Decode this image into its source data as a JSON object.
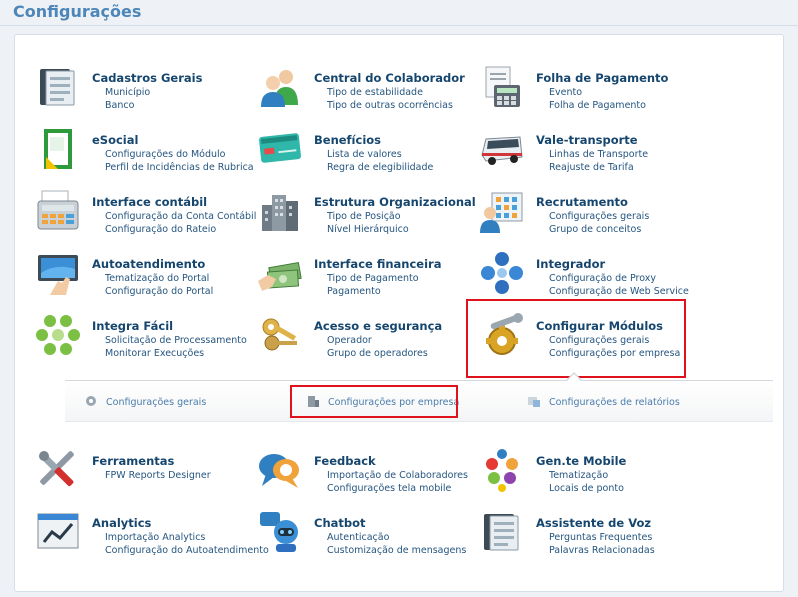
{
  "page": {
    "title": "Configurações"
  },
  "modules": {
    "cadastros": {
      "title": "Cadastros Gerais",
      "links": [
        "Município",
        "Banco"
      ]
    },
    "colaborador": {
      "title": "Central do Colaborador",
      "links": [
        "Tipo de estabilidade",
        "Tipo de outras ocorrências"
      ]
    },
    "folha": {
      "title": "Folha de Pagamento",
      "links": [
        "Evento",
        "Folha de Pagamento"
      ]
    },
    "esocial": {
      "title": "eSocial",
      "links": [
        "Configurações do Módulo",
        "Perfil de Incidências de Rubrica"
      ]
    },
    "beneficios": {
      "title": "Benefícios",
      "links": [
        "Lista de valores",
        "Regra de elegibilidade"
      ]
    },
    "vale": {
      "title": "Vale-transporte",
      "links": [
        "Linhas de Transporte",
        "Reajuste de Tarifa"
      ]
    },
    "contabil": {
      "title": "Interface contábil",
      "links": [
        "Configuração da Conta Contábil",
        "Configuração do Rateio"
      ]
    },
    "estrutura": {
      "title": "Estrutura Organizacional",
      "links": [
        "Tipo de Posição",
        "Nível Hierárquico"
      ]
    },
    "recrutamento": {
      "title": "Recrutamento",
      "links": [
        "Configurações gerais",
        "Grupo de conceitos"
      ]
    },
    "autoatendimento": {
      "title": "Autoatendimento",
      "links": [
        "Tematização do Portal",
        "Configuração do Portal"
      ]
    },
    "financeira": {
      "title": "Interface financeira",
      "links": [
        "Tipo de Pagamento",
        "Pagamento"
      ]
    },
    "integrador": {
      "title": "Integrador",
      "links": [
        "Configuração de Proxy",
        "Configuração de Web Service"
      ]
    },
    "integra": {
      "title": "Integra Fácil",
      "links": [
        "Solicitação de Processamento",
        "Monitorar Execuções"
      ]
    },
    "acesso": {
      "title": "Acesso e segurança",
      "links": [
        "Operador",
        "Grupo de operadores"
      ]
    },
    "modulos": {
      "title": "Configurar Módulos",
      "links": [
        "Configurações gerais",
        "Configurações por empresa"
      ]
    },
    "ferramentas": {
      "title": "Ferramentas",
      "links": [
        "FPW Reports Designer"
      ]
    },
    "feedback": {
      "title": "Feedback",
      "links": [
        "Importação de Colaboradores",
        "Configurações tela mobile"
      ]
    },
    "mobile": {
      "title": "Gen.te Mobile",
      "links": [
        "Tematização",
        "Locais de ponto"
      ]
    },
    "analytics": {
      "title": "Analytics",
      "links": [
        "Importação Analytics",
        "Configuração do Autoatendimento"
      ]
    },
    "chatbot": {
      "title": "Chatbot",
      "links": [
        "Autenticação",
        "Customização de mensagens"
      ]
    },
    "voz": {
      "title": "Assistente de Voz",
      "links": [
        "Perguntas Frequentes",
        "Palavras Relacionadas"
      ]
    }
  },
  "submenu": {
    "items": [
      "Configurações gerais",
      "Configurações por empresa",
      "Configurações de relatórios"
    ]
  },
  "colors": {
    "title": "#4d86b8",
    "module_title": "#16466e",
    "link": "#25557f",
    "highlight": "#e0121b"
  }
}
